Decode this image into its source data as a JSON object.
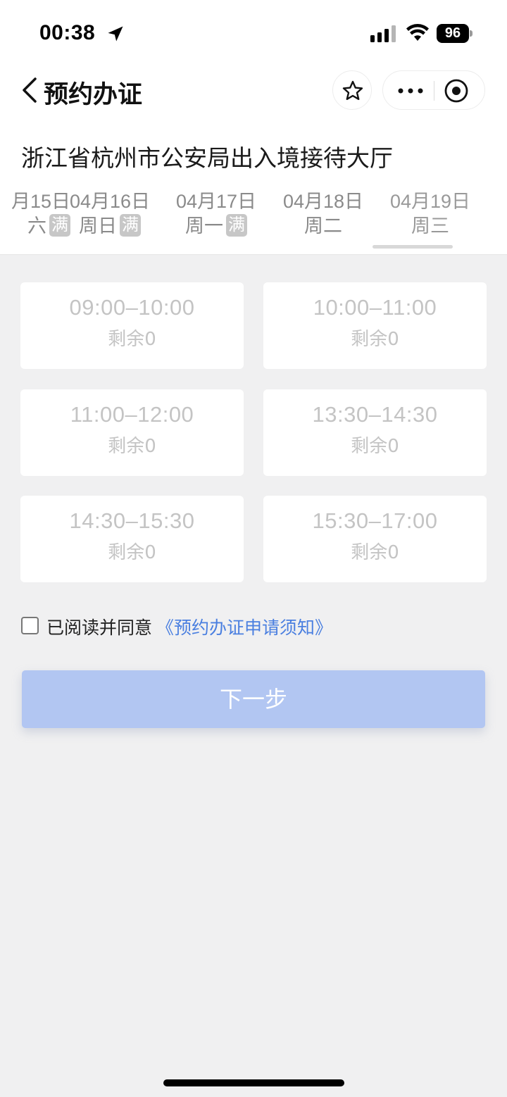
{
  "status_bar": {
    "time": "00:38",
    "battery": "96"
  },
  "nav": {
    "title": "预约办证"
  },
  "hall": {
    "title": "浙江省杭州市公安局出入境接待大厅"
  },
  "dates": [
    {
      "date": "月15日",
      "weekday": "六",
      "badge": "满"
    },
    {
      "date": "04月16日",
      "weekday": "周日",
      "badge": "满"
    },
    {
      "date": "04月17日",
      "weekday": "周一",
      "badge": "满"
    },
    {
      "date": "04月18日",
      "weekday": "周二",
      "badge": ""
    },
    {
      "date": "04月19日",
      "weekday": "周三",
      "badge": ""
    }
  ],
  "selected_date_index": 4,
  "slots": [
    {
      "time": "09:00–10:00",
      "remaining": "剩余0"
    },
    {
      "time": "10:00–11:00",
      "remaining": "剩余0"
    },
    {
      "time": "11:00–12:00",
      "remaining": "剩余0"
    },
    {
      "time": "13:30–14:30",
      "remaining": "剩余0"
    },
    {
      "time": "14:30–15:30",
      "remaining": "剩余0"
    },
    {
      "time": "15:30–17:00",
      "remaining": "剩余0"
    }
  ],
  "agreement": {
    "text": "已阅读并同意",
    "link": "《预约办证申请须知》",
    "checked": false
  },
  "next_button": {
    "label": "下一步"
  },
  "colors": {
    "link": "#4a7fe0",
    "button_disabled": "#b2c6f2",
    "background": "#f0f0f1"
  }
}
